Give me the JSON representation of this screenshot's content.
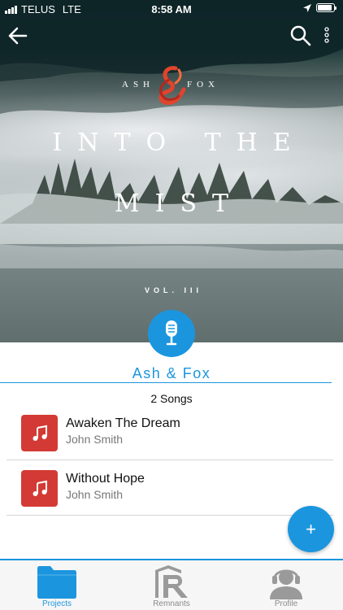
{
  "status_bar": {
    "carrier": "TELUS",
    "network": "LTE",
    "time": "8:58 AM"
  },
  "hero": {
    "brand_left": "ASH",
    "brand_right": "FOX",
    "album_title_line1": "INTO THE",
    "album_title_line2": "MIST",
    "volume": "VOL. III"
  },
  "artist": {
    "name": "Ash & Fox",
    "song_count": "2 Songs"
  },
  "songs": [
    {
      "title": "Awaken The Dream",
      "artist": "John Smith"
    },
    {
      "title": "Without Hope",
      "artist": "John Smith"
    }
  ],
  "fab": {
    "label": "+"
  },
  "tabs": [
    {
      "label": "Projects",
      "icon": "folder-icon",
      "active": true
    },
    {
      "label": "Remnants",
      "icon": "remnants-logo-icon",
      "active": false
    },
    {
      "label": "Profile",
      "icon": "headset-user-icon",
      "active": false
    }
  ],
  "colors": {
    "accent": "#1b96de",
    "song_art": "#d33a35",
    "tab_inactive": "#8a8a8a"
  }
}
